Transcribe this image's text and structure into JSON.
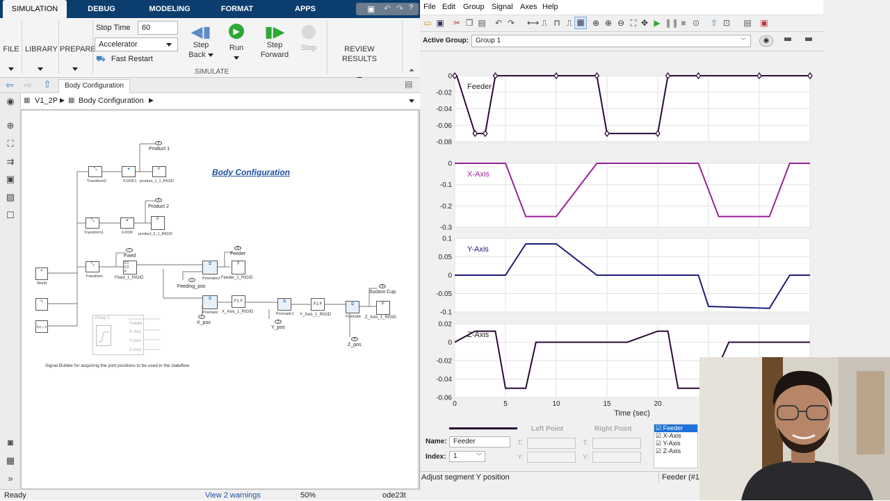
{
  "simulink": {
    "tabs": [
      "SIMULATION",
      "DEBUG",
      "MODELING",
      "FORMAT",
      "APPS"
    ],
    "sections": {
      "file": "FILE",
      "library": "LIBRARY",
      "prepare": "PREPARE",
      "review": "REVIEW RESULTS",
      "simulate": "SIMULATE"
    },
    "stop_time_label": "Stop Time",
    "stop_time_value": "60",
    "sim_mode": "Accelerator",
    "fast_restart": "Fast Restart",
    "step_back": "Step",
    "step_back_2": "Back",
    "run": "Run",
    "step_forward": "Step",
    "step_forward_2": "Forward",
    "stop": "Stop",
    "nav_tab": "Body Configuration",
    "breadcrumb": [
      "V1_2P",
      "Body Configuration"
    ],
    "canvas": {
      "title": "Body Configuration",
      "ports": {
        "p5": "5",
        "product1": "Product 1",
        "p6": "6",
        "product2": "Product 2",
        "p7": "7",
        "fixed": "Fixed",
        "p8": "8",
        "feeder": "Feeder",
        "p1": "1",
        "feeding_pos": "Feeding_pos",
        "p2": "2",
        "x_pos": "X_pos",
        "p3": "3",
        "y_pos": "Y_pos",
        "p4": "4",
        "z_pos": "Z_pos",
        "p9": "9",
        "suction_cup": "Suction Cup"
      },
      "blocks": {
        "world": "World",
        "transform2": "Transform2",
        "transform1": "Transform1",
        "transform": "Transform",
        "sixdof1": "6-DOF1",
        "sixdof": "6-DOF",
        "product11": "product_1_1_RIGID",
        "product21": "product_2_1_RIGID",
        "fixed1": "Fixed_1_RIGID",
        "feeder1": "Feeder_1_RIGID",
        "prismatic2": "Prismatic2",
        "prismatic": "Prismatic",
        "prismatic1": "Prismatic1",
        "x_axis_rigid": "X_Axis_1_RIGID",
        "y_axis_rigid": "Y_Axis_1_RIGID",
        "z_axis_rigid": "Z_Axis_1_RIGID",
        "f": "F",
        "f1": "F1",
        "f2": "F2",
        "fx": "f(x) = 0"
      },
      "group_block": {
        "title": "Group 1",
        "signals": [
          "Feeder",
          "X-Axis",
          "Y-Axis",
          "Z-Axis"
        ]
      },
      "caption": "Signal Builder for acquiring the joint positions to be used in the stateflow"
    },
    "status": {
      "ready": "Ready",
      "warnings": "View 2 warnings",
      "zoom": "50%",
      "solver": "ode23t"
    }
  },
  "signal_builder": {
    "menu": [
      "File",
      "Edit",
      "Group",
      "Signal",
      "Axes",
      "Help"
    ],
    "active_group_label": "Active Group:",
    "active_group_value": "Group 1",
    "xlabel": "Time (sec)",
    "name_label": "Name:",
    "name_value": "Feeder",
    "index_label": "Index:",
    "index_value": "1",
    "left_point": "Left Point",
    "right_point": "Right Point",
    "t_label": "T:",
    "y_label": "Y:",
    "signal_list": [
      "Feeder",
      "X-Axis",
      "Y-Axis",
      "Z-Axis"
    ],
    "status_left": "Adjust segment Y position",
    "status_right": "Feeder (#1)"
  },
  "chart_data": [
    {
      "type": "line",
      "title": "",
      "xlabel": "",
      "ylabel": "",
      "xlim": [
        0,
        35
      ],
      "ylim": [
        -0.08,
        0
      ],
      "yticks": [
        "0",
        "-0.02",
        "-0.04",
        "-0.06",
        "-0.08"
      ],
      "series": [
        {
          "name": "Feeder",
          "color": "#2a0a33",
          "x": [
            0,
            0.2,
            2,
            3,
            4,
            10,
            14,
            15,
            20,
            21,
            24,
            30,
            35
          ],
          "y": [
            0,
            0,
            -0.07,
            -0.07,
            0,
            0,
            0,
            -0.07,
            -0.07,
            0,
            0,
            0,
            0
          ]
        }
      ]
    },
    {
      "type": "line",
      "title": "",
      "xlabel": "",
      "ylabel": "",
      "xlim": [
        0,
        35
      ],
      "ylim": [
        -0.3,
        0
      ],
      "yticks": [
        "0",
        "-0.1",
        "-0.2",
        "-0.3"
      ],
      "series": [
        {
          "name": "X-Axis",
          "color": "#9c1f9c",
          "x": [
            0,
            5,
            7,
            10,
            14,
            24,
            26,
            31,
            33,
            35
          ],
          "y": [
            0,
            0,
            -0.25,
            -0.25,
            0,
            0,
            -0.25,
            -0.25,
            0,
            0
          ]
        }
      ]
    },
    {
      "type": "line",
      "title": "",
      "xlabel": "",
      "ylabel": "",
      "xlim": [
        0,
        35
      ],
      "ylim": [
        -0.1,
        0.1
      ],
      "yticks": [
        "0.1",
        "0.05",
        "0",
        "-0.05",
        "-0.1"
      ],
      "series": [
        {
          "name": "Y-Axis",
          "color": "#1c1c7a",
          "x": [
            0,
            5,
            7,
            10,
            14,
            24,
            25,
            31,
            33,
            35
          ],
          "y": [
            0,
            0,
            0.085,
            0.085,
            0,
            0,
            -0.085,
            -0.09,
            0,
            0
          ]
        }
      ]
    },
    {
      "type": "line",
      "title": "",
      "xlabel": "Time (sec)",
      "ylabel": "",
      "xlim": [
        0,
        35
      ],
      "ylim": [
        -0.06,
        0.02
      ],
      "yticks": [
        "0.02",
        "0",
        "-0.02",
        "-0.04",
        "-0.06"
      ],
      "xticks": [
        "0",
        "5",
        "10",
        "15",
        "20"
      ],
      "series": [
        {
          "name": "Z-Axis",
          "color": "#2a0a33",
          "x": [
            0,
            2,
            4,
            5,
            7,
            8,
            10,
            17,
            20,
            21,
            22,
            25,
            27,
            35
          ],
          "y": [
            0,
            0.012,
            0.012,
            -0.05,
            -0.05,
            0,
            0,
            0,
            0.012,
            0.012,
            -0.05,
            -0.05,
            0,
            0
          ]
        }
      ]
    }
  ],
  "colors": {
    "tab_bar": "#0b3d6e",
    "feeder": "#2a0a33",
    "x_axis": "#9c1f9c",
    "y_axis": "#1c1c7a",
    "run_green": "#2ea836",
    "title_blue": "#1c4fa1"
  }
}
